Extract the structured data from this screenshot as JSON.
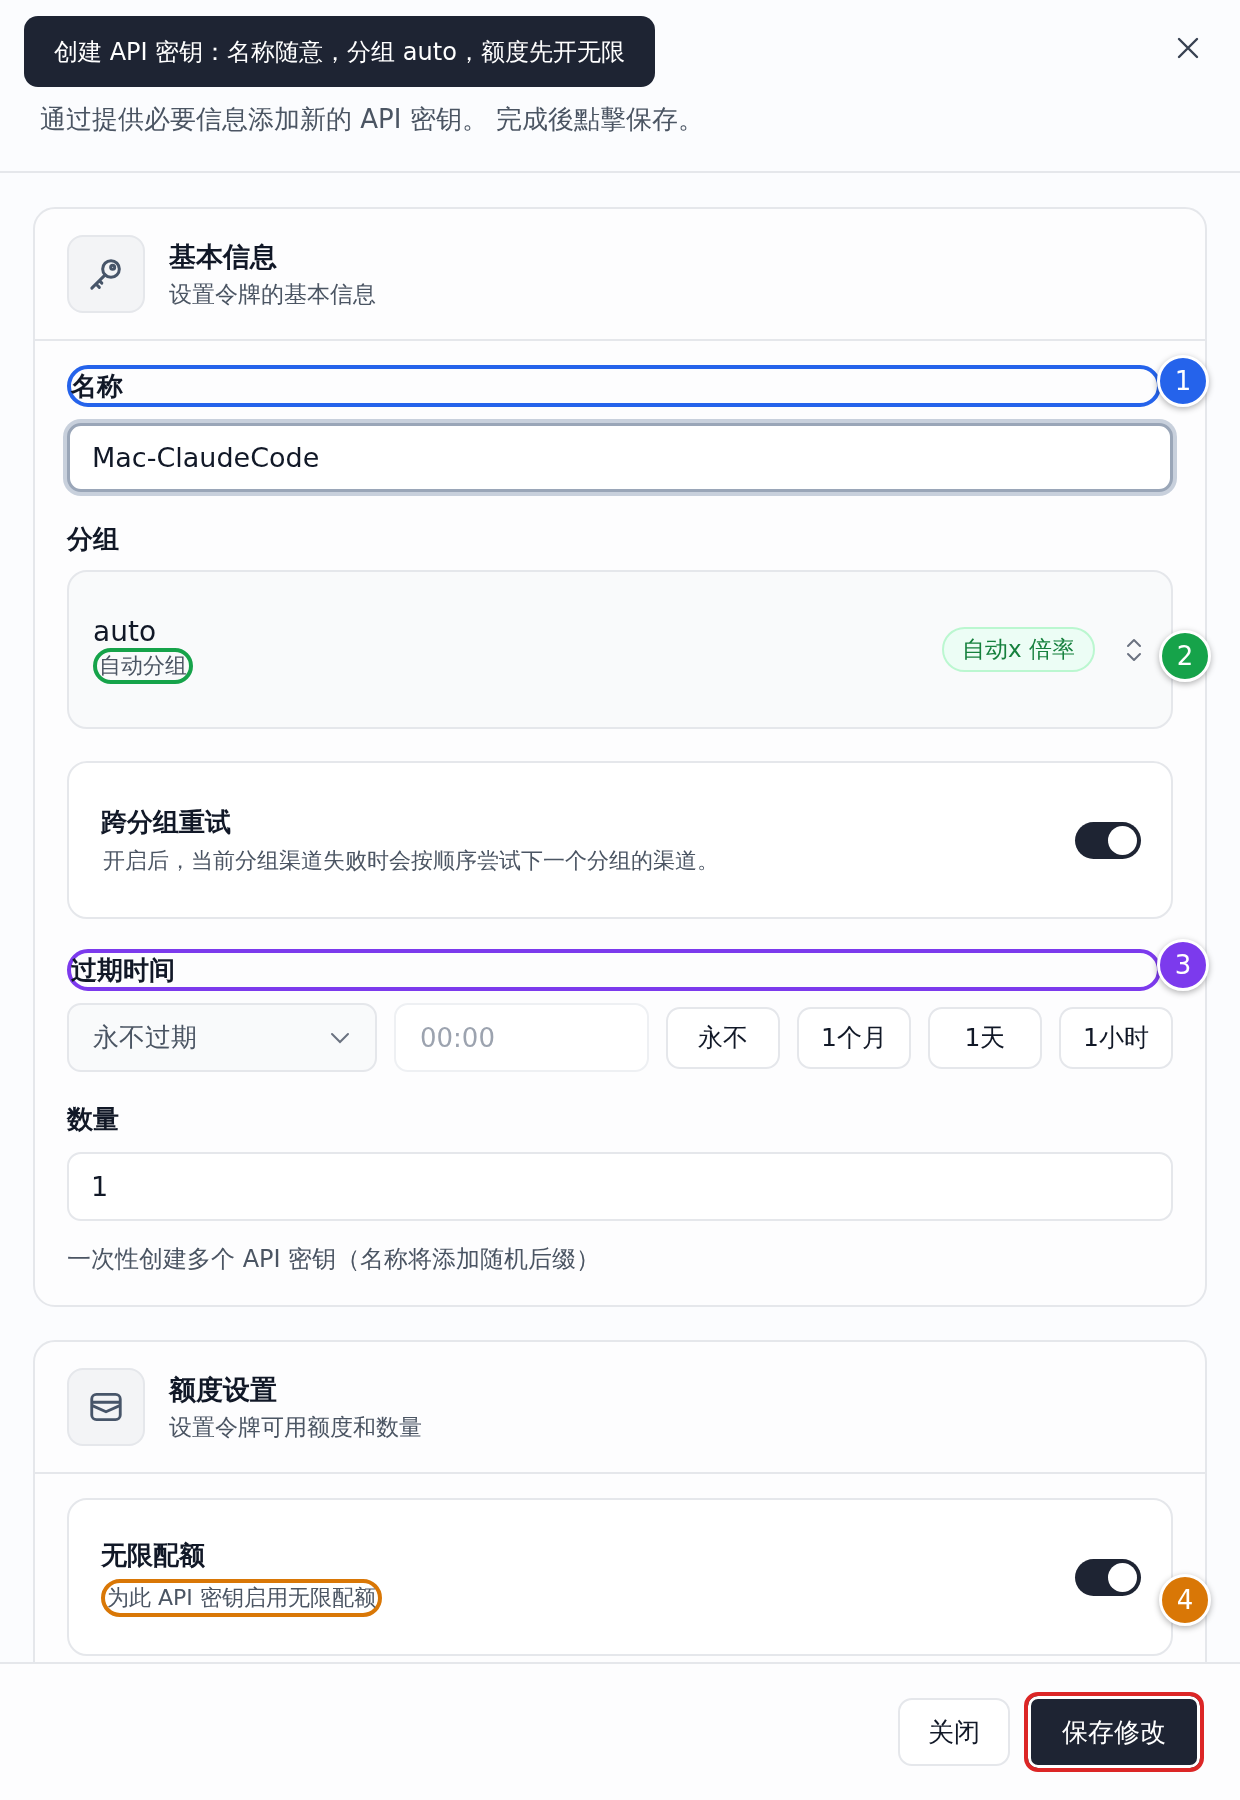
{
  "tooltip": "创建 API 密钥：名称随意，分组 auto，额度先开无限",
  "dialog": {
    "subtitle": "通过提供必要信息添加新的 API 密钥。 完成後點擊保存。"
  },
  "basic_section": {
    "title": "基本信息",
    "subtitle": "设置令牌的基本信息",
    "name_field": {
      "label": "名称",
      "value": "Mac-ClaudeCode",
      "focused": true,
      "callout": {
        "number": "1",
        "color": "#2563eb"
      }
    },
    "group_field": {
      "label": "分组",
      "value": "auto",
      "description": "自动分组",
      "badge": "自动x 倍率",
      "callout": {
        "number": "2",
        "color": "#16a34a"
      }
    },
    "retry_toggle": {
      "title": "跨分组重试",
      "description": "开启后，当前分组渠道失败时会按顺序尝试下一个分组的渠道。",
      "on": true
    },
    "expiry": {
      "label": "过期时间",
      "callout": {
        "number": "3",
        "color": "#7c3aed"
      },
      "select": "永不过期",
      "time_placeholder": "00:00",
      "presets": [
        "永不",
        "1个月",
        "1天",
        "1小时"
      ]
    },
    "quantity": {
      "label": "数量",
      "value": "1",
      "hint": "一次性创建多个 API 密钥（名称将添加随机后缀）"
    }
  },
  "quota_section": {
    "title": "额度设置",
    "subtitle": "设置令牌可用额度和数量",
    "unlimited_toggle": {
      "title": "无限配额",
      "description": "为此 API 密钥启用无限配额",
      "on": true,
      "callout": {
        "number": "4",
        "color": "#d97706"
      }
    }
  },
  "footer": {
    "buttons": [
      {
        "label": "关闭",
        "kind": "secondary",
        "highlighted": false
      },
      {
        "label": "保存修改",
        "kind": "primary",
        "highlighted": true
      }
    ]
  }
}
